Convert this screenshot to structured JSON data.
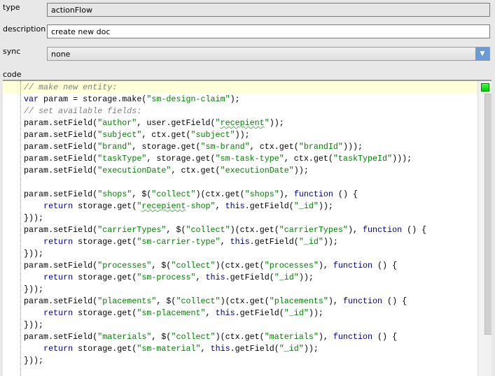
{
  "form": {
    "type_label": "type",
    "type_value": "actionFlow",
    "description_label": "description",
    "description_value": "create new doc",
    "sync_label": "sync",
    "sync_value": "none",
    "code_label": "code"
  },
  "editor": {
    "status_color": "#00cc00",
    "lines": [
      [
        [
          "c",
          "// make new entity:"
        ]
      ],
      [
        [
          "k",
          "var"
        ],
        [
          "p",
          " param = storage.make("
        ],
        [
          "s",
          "\"sm-design-claim\""
        ],
        [
          "p",
          ");"
        ]
      ],
      [
        [
          "c",
          "// set available fields:"
        ]
      ],
      [
        [
          "p",
          "param.setField("
        ],
        [
          "s",
          "\"author\""
        ],
        [
          "p",
          ", user.getField("
        ],
        [
          "s",
          "\""
        ],
        [
          "sq",
          "recepient"
        ],
        [
          "s",
          "\""
        ],
        [
          "p",
          "));"
        ]
      ],
      [
        [
          "p",
          "param.setField("
        ],
        [
          "s",
          "\"subject\""
        ],
        [
          "p",
          ", ctx.get("
        ],
        [
          "s",
          "\"subject\""
        ],
        [
          "p",
          "));"
        ]
      ],
      [
        [
          "p",
          "param.setField("
        ],
        [
          "s",
          "\"brand\""
        ],
        [
          "p",
          ", storage.get("
        ],
        [
          "s",
          "\"sm-brand\""
        ],
        [
          "p",
          ", ctx.get("
        ],
        [
          "s",
          "\"brandId\""
        ],
        [
          "p",
          ")));"
        ]
      ],
      [
        [
          "p",
          "param.setField("
        ],
        [
          "s",
          "\"taskType\""
        ],
        [
          "p",
          ", storage.get("
        ],
        [
          "s",
          "\"sm-task-type\""
        ],
        [
          "p",
          ", ctx.get("
        ],
        [
          "s",
          "\"taskTypeId\""
        ],
        [
          "p",
          ")));"
        ]
      ],
      [
        [
          "p",
          "param.setField("
        ],
        [
          "s",
          "\"executionDate\""
        ],
        [
          "p",
          ", ctx.get("
        ],
        [
          "s",
          "\"executionDate\""
        ],
        [
          "p",
          "));"
        ]
      ],
      [],
      [
        [
          "p",
          "param.setField("
        ],
        [
          "s",
          "\"shops\""
        ],
        [
          "p",
          ", $("
        ],
        [
          "s",
          "\"collect\""
        ],
        [
          "p",
          ")(ctx.get("
        ],
        [
          "s",
          "\"shops\""
        ],
        [
          "p",
          "), "
        ],
        [
          "k",
          "function"
        ],
        [
          "p",
          " () {"
        ]
      ],
      [
        [
          "p",
          "    "
        ],
        [
          "k",
          "return"
        ],
        [
          "p",
          " storage.get("
        ],
        [
          "s",
          "\""
        ],
        [
          "sq",
          "recepient"
        ],
        [
          "s",
          "-shop\""
        ],
        [
          "p",
          ", "
        ],
        [
          "k",
          "this"
        ],
        [
          "p",
          ".getField("
        ],
        [
          "s",
          "\"_id\""
        ],
        [
          "p",
          "));"
        ]
      ],
      [
        [
          "p",
          "}));"
        ]
      ],
      [
        [
          "p",
          "param.setField("
        ],
        [
          "s",
          "\"carrierTypes\""
        ],
        [
          "p",
          ", $("
        ],
        [
          "s",
          "\"collect\""
        ],
        [
          "p",
          ")(ctx.get("
        ],
        [
          "s",
          "\"carrierTypes\""
        ],
        [
          "p",
          "), "
        ],
        [
          "k",
          "function"
        ],
        [
          "p",
          " () {"
        ]
      ],
      [
        [
          "p",
          "    "
        ],
        [
          "k",
          "return"
        ],
        [
          "p",
          " storage.get("
        ],
        [
          "s",
          "\"sm-carrier-type\""
        ],
        [
          "p",
          ", "
        ],
        [
          "k",
          "this"
        ],
        [
          "p",
          ".getField("
        ],
        [
          "s",
          "\"_id\""
        ],
        [
          "p",
          "));"
        ]
      ],
      [
        [
          "p",
          "}));"
        ]
      ],
      [
        [
          "p",
          "param.setField("
        ],
        [
          "s",
          "\"processes\""
        ],
        [
          "p",
          ", $("
        ],
        [
          "s",
          "\"collect\""
        ],
        [
          "p",
          ")(ctx.get("
        ],
        [
          "s",
          "\"processes\""
        ],
        [
          "p",
          "), "
        ],
        [
          "k",
          "function"
        ],
        [
          "p",
          " () {"
        ]
      ],
      [
        [
          "p",
          "    "
        ],
        [
          "k",
          "return"
        ],
        [
          "p",
          " storage.get("
        ],
        [
          "s",
          "\"sm-process\""
        ],
        [
          "p",
          ", "
        ],
        [
          "k",
          "this"
        ],
        [
          "p",
          ".getField("
        ],
        [
          "s",
          "\"_id\""
        ],
        [
          "p",
          "));"
        ]
      ],
      [
        [
          "p",
          "}));"
        ]
      ],
      [
        [
          "p",
          "param.setField("
        ],
        [
          "s",
          "\"placements\""
        ],
        [
          "p",
          ", $("
        ],
        [
          "s",
          "\"collect\""
        ],
        [
          "p",
          ")(ctx.get("
        ],
        [
          "s",
          "\"placements\""
        ],
        [
          "p",
          "), "
        ],
        [
          "k",
          "function"
        ],
        [
          "p",
          " () {"
        ]
      ],
      [
        [
          "p",
          "    "
        ],
        [
          "k",
          "return"
        ],
        [
          "p",
          " storage.get("
        ],
        [
          "s",
          "\"sm-placement\""
        ],
        [
          "p",
          ", "
        ],
        [
          "k",
          "this"
        ],
        [
          "p",
          ".getField("
        ],
        [
          "s",
          "\"_id\""
        ],
        [
          "p",
          "));"
        ]
      ],
      [
        [
          "p",
          "}));"
        ]
      ],
      [
        [
          "p",
          "param.setField("
        ],
        [
          "s",
          "\"materials\""
        ],
        [
          "p",
          ", $("
        ],
        [
          "s",
          "\"collect\""
        ],
        [
          "p",
          ")(ctx.get("
        ],
        [
          "s",
          "\"materials\""
        ],
        [
          "p",
          "), "
        ],
        [
          "k",
          "function"
        ],
        [
          "p",
          " () {"
        ]
      ],
      [
        [
          "p",
          "    "
        ],
        [
          "k",
          "return"
        ],
        [
          "p",
          " storage.get("
        ],
        [
          "s",
          "\"sm-material\""
        ],
        [
          "p",
          ", "
        ],
        [
          "k",
          "this"
        ],
        [
          "p",
          ".getField("
        ],
        [
          "s",
          "\"_id\""
        ],
        [
          "p",
          "));"
        ]
      ],
      [
        [
          "p",
          "}));"
        ]
      ]
    ]
  }
}
